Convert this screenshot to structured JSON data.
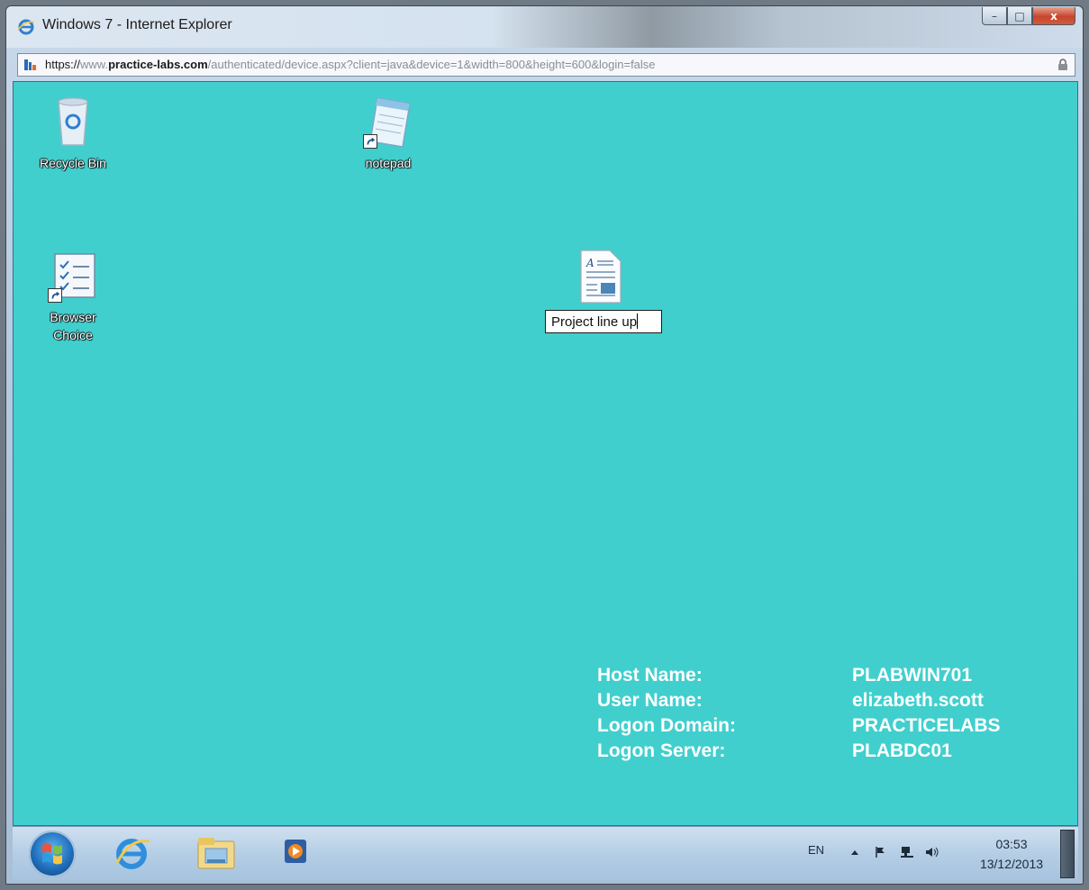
{
  "window": {
    "title": "Windows 7 - Internet Explorer",
    "buttons": {
      "minimize": "–",
      "maximize": "□",
      "close": "x"
    }
  },
  "address": {
    "scheme": "https://",
    "prefix": "www.",
    "host": "practice-labs.com",
    "path": "/authenticated/device.aspx?client=java&device=1&width=800&height=600&login=false"
  },
  "desktop": {
    "background": "#41cfce",
    "icons": [
      {
        "label": "Recycle Bin",
        "icon": "recycle-bin-icon"
      },
      {
        "label": "notepad",
        "icon": "notepad-icon"
      },
      {
        "label_line1": "Browser",
        "label_line2": "Choice",
        "icon": "browser-choice-icon"
      },
      {
        "icon": "document-icon"
      }
    ],
    "rename_value": "Project line up"
  },
  "bginfo": [
    {
      "key": "Host Name:",
      "value": "PLABWIN701"
    },
    {
      "key": "User Name:",
      "value": "elizabeth.scott"
    },
    {
      "key": "Logon Domain:",
      "value": "PRACTICELABS"
    },
    {
      "key": "Logon Server:",
      "value": "PLABDC01"
    }
  ],
  "taskbar": {
    "apps": [
      "internet-explorer-icon",
      "windows-explorer-icon",
      "media-player-icon"
    ],
    "tray": {
      "language": "EN",
      "time": "03:53",
      "date": "13/12/2013"
    }
  }
}
